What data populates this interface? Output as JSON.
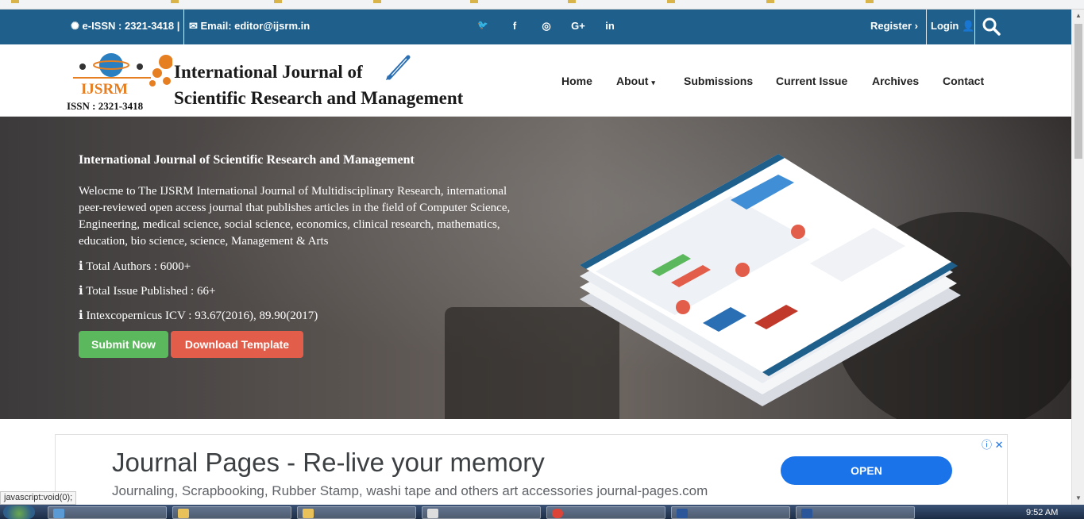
{
  "topbar": {
    "issn": "e-ISSN : 2321-3418 |",
    "email": "Email: editor@ijsrm.in",
    "social_icons": [
      "twitter-icon",
      "facebook-icon",
      "instagram-icon",
      "google-plus-icon",
      "linkedin-icon"
    ],
    "social_glyphs": [
      "🐦",
      "f",
      "◎",
      "G+",
      "in"
    ],
    "register": "Register",
    "login": "Login"
  },
  "header": {
    "logo_text": "IJSRM",
    "logo_issn": "ISSN : 2321-3418",
    "brand_line1": "International Journal of",
    "brand_line2": "Scientific Research and Management",
    "nav": [
      "Home",
      "About",
      "Submissions",
      "Current Issue",
      "Archives",
      "Contact"
    ]
  },
  "hero": {
    "title": "International Journal of Scientific Research and Management",
    "description": "Welocme to The IJSRM International Journal of Multidisciplinary Research, international peer-reviewed open access journal that publishes articles in the field of Computer Science, Engineering, medical science, social science, economics, clinical research, mathematics, education, bio science, science, Management & Arts",
    "stats": [
      "Total Authors : 6000+",
      "Total Issue Published : 66+",
      "Intexcopernicus ICV : 93.67(2016), 89.90(2017)"
    ],
    "submit_button": "Submit Now",
    "download_button": "Download Template"
  },
  "ad": {
    "title": "Journal Pages - Re-live your memory",
    "subtitle": "Journaling, Scrapbooking, Rubber Stamp, washi tape and others art accessories journal-pages.com",
    "button": "OPEN"
  },
  "status_link": "javascript:void(0);",
  "taskbar": {
    "clock": "9:52 AM"
  },
  "colors": {
    "topbar": "#1f5f8b",
    "submit": "#5cb85c",
    "download": "#e35e4a",
    "ad_button": "#1a73e8"
  }
}
